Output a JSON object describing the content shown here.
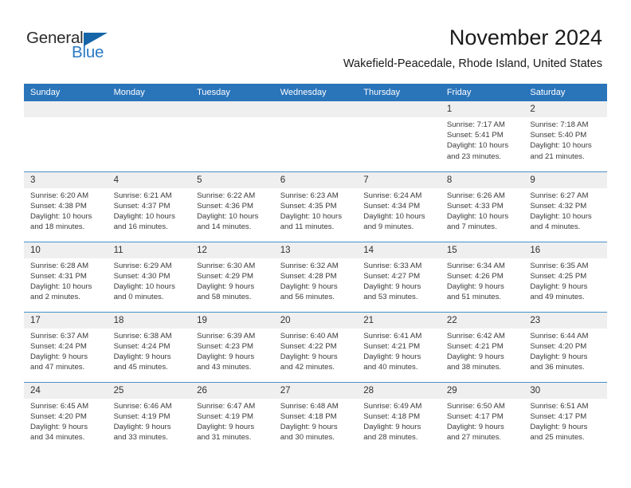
{
  "brand": {
    "name_part1": "General",
    "name_part2": "Blue",
    "accent_color": "#2a7ac4",
    "triangle_color": "#1565a8"
  },
  "header": {
    "month_title": "November 2024",
    "location": "Wakefield-Peacedale, Rhode Island, United States"
  },
  "theme": {
    "header_bar_color": "#2a74ba",
    "daynum_band_color": "#efefef",
    "row_divider_color": "#4a8fc9"
  },
  "calendar": {
    "weekday_headers": [
      "Sunday",
      "Monday",
      "Tuesday",
      "Wednesday",
      "Thursday",
      "Friday",
      "Saturday"
    ],
    "weeks": [
      [
        {
          "day": "",
          "info": ""
        },
        {
          "day": "",
          "info": ""
        },
        {
          "day": "",
          "info": ""
        },
        {
          "day": "",
          "info": ""
        },
        {
          "day": "",
          "info": ""
        },
        {
          "day": "1",
          "info": "Sunrise: 7:17 AM\nSunset: 5:41 PM\nDaylight: 10 hours\nand 23 minutes."
        },
        {
          "day": "2",
          "info": "Sunrise: 7:18 AM\nSunset: 5:40 PM\nDaylight: 10 hours\nand 21 minutes."
        }
      ],
      [
        {
          "day": "3",
          "info": "Sunrise: 6:20 AM\nSunset: 4:38 PM\nDaylight: 10 hours\nand 18 minutes."
        },
        {
          "day": "4",
          "info": "Sunrise: 6:21 AM\nSunset: 4:37 PM\nDaylight: 10 hours\nand 16 minutes."
        },
        {
          "day": "5",
          "info": "Sunrise: 6:22 AM\nSunset: 4:36 PM\nDaylight: 10 hours\nand 14 minutes."
        },
        {
          "day": "6",
          "info": "Sunrise: 6:23 AM\nSunset: 4:35 PM\nDaylight: 10 hours\nand 11 minutes."
        },
        {
          "day": "7",
          "info": "Sunrise: 6:24 AM\nSunset: 4:34 PM\nDaylight: 10 hours\nand 9 minutes."
        },
        {
          "day": "8",
          "info": "Sunrise: 6:26 AM\nSunset: 4:33 PM\nDaylight: 10 hours\nand 7 minutes."
        },
        {
          "day": "9",
          "info": "Sunrise: 6:27 AM\nSunset: 4:32 PM\nDaylight: 10 hours\nand 4 minutes."
        }
      ],
      [
        {
          "day": "10",
          "info": "Sunrise: 6:28 AM\nSunset: 4:31 PM\nDaylight: 10 hours\nand 2 minutes."
        },
        {
          "day": "11",
          "info": "Sunrise: 6:29 AM\nSunset: 4:30 PM\nDaylight: 10 hours\nand 0 minutes."
        },
        {
          "day": "12",
          "info": "Sunrise: 6:30 AM\nSunset: 4:29 PM\nDaylight: 9 hours\nand 58 minutes."
        },
        {
          "day": "13",
          "info": "Sunrise: 6:32 AM\nSunset: 4:28 PM\nDaylight: 9 hours\nand 56 minutes."
        },
        {
          "day": "14",
          "info": "Sunrise: 6:33 AM\nSunset: 4:27 PM\nDaylight: 9 hours\nand 53 minutes."
        },
        {
          "day": "15",
          "info": "Sunrise: 6:34 AM\nSunset: 4:26 PM\nDaylight: 9 hours\nand 51 minutes."
        },
        {
          "day": "16",
          "info": "Sunrise: 6:35 AM\nSunset: 4:25 PM\nDaylight: 9 hours\nand 49 minutes."
        }
      ],
      [
        {
          "day": "17",
          "info": "Sunrise: 6:37 AM\nSunset: 4:24 PM\nDaylight: 9 hours\nand 47 minutes."
        },
        {
          "day": "18",
          "info": "Sunrise: 6:38 AM\nSunset: 4:24 PM\nDaylight: 9 hours\nand 45 minutes."
        },
        {
          "day": "19",
          "info": "Sunrise: 6:39 AM\nSunset: 4:23 PM\nDaylight: 9 hours\nand 43 minutes."
        },
        {
          "day": "20",
          "info": "Sunrise: 6:40 AM\nSunset: 4:22 PM\nDaylight: 9 hours\nand 42 minutes."
        },
        {
          "day": "21",
          "info": "Sunrise: 6:41 AM\nSunset: 4:21 PM\nDaylight: 9 hours\nand 40 minutes."
        },
        {
          "day": "22",
          "info": "Sunrise: 6:42 AM\nSunset: 4:21 PM\nDaylight: 9 hours\nand 38 minutes."
        },
        {
          "day": "23",
          "info": "Sunrise: 6:44 AM\nSunset: 4:20 PM\nDaylight: 9 hours\nand 36 minutes."
        }
      ],
      [
        {
          "day": "24",
          "info": "Sunrise: 6:45 AM\nSunset: 4:20 PM\nDaylight: 9 hours\nand 34 minutes."
        },
        {
          "day": "25",
          "info": "Sunrise: 6:46 AM\nSunset: 4:19 PM\nDaylight: 9 hours\nand 33 minutes."
        },
        {
          "day": "26",
          "info": "Sunrise: 6:47 AM\nSunset: 4:19 PM\nDaylight: 9 hours\nand 31 minutes."
        },
        {
          "day": "27",
          "info": "Sunrise: 6:48 AM\nSunset: 4:18 PM\nDaylight: 9 hours\nand 30 minutes."
        },
        {
          "day": "28",
          "info": "Sunrise: 6:49 AM\nSunset: 4:18 PM\nDaylight: 9 hours\nand 28 minutes."
        },
        {
          "day": "29",
          "info": "Sunrise: 6:50 AM\nSunset: 4:17 PM\nDaylight: 9 hours\nand 27 minutes."
        },
        {
          "day": "30",
          "info": "Sunrise: 6:51 AM\nSunset: 4:17 PM\nDaylight: 9 hours\nand 25 minutes."
        }
      ]
    ]
  }
}
